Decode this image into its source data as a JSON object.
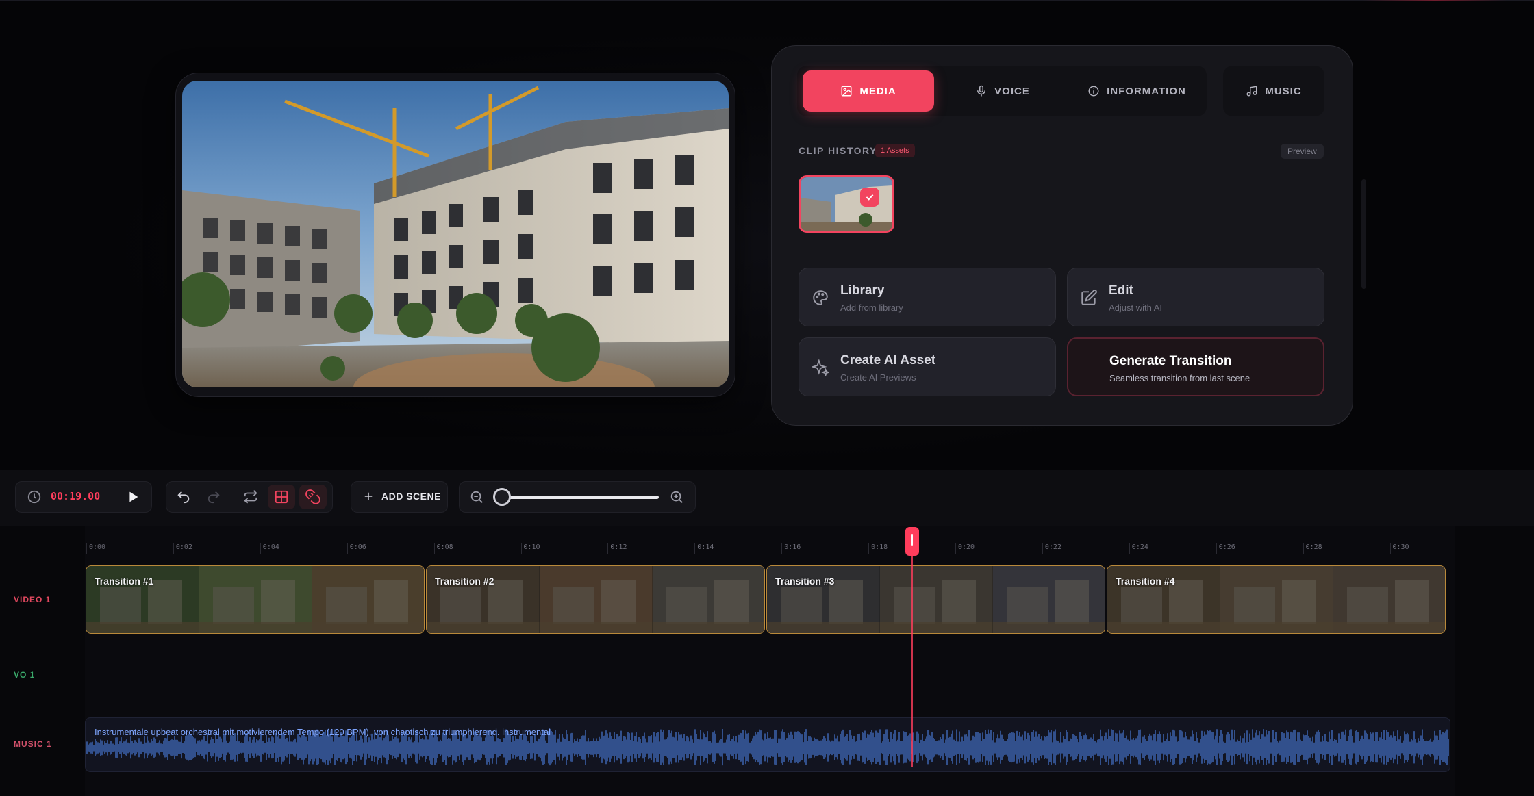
{
  "colors": {
    "accent": "#f2445f",
    "background": "#050507",
    "panel": "#16161b",
    "clip_border": "#b9893a",
    "video_label": "#e0485f",
    "vo_label": "#3aa86a",
    "music_label": "#d0506a",
    "music_wave": "#3b5fa8"
  },
  "tabs": [
    {
      "label": "MEDIA",
      "icon": "image-icon",
      "active": true
    },
    {
      "label": "VOICE",
      "icon": "microphone-icon",
      "active": false
    },
    {
      "label": "INFORMATION",
      "icon": "info-icon",
      "active": false
    },
    {
      "label": "MUSIC",
      "icon": "music-note-icon",
      "active": false
    }
  ],
  "clip_history": {
    "label": "CLIP HISTORY",
    "badge": "1 Assets",
    "preview_label": "Preview"
  },
  "actions": [
    {
      "title": "Library",
      "subtitle": "Add from library",
      "icon": "palette-icon"
    },
    {
      "title": "Edit",
      "subtitle": "Adjust with AI",
      "icon": "edit-icon"
    },
    {
      "title": "Create AI Asset",
      "subtitle": "Create AI Previews",
      "icon": "sparkles-icon"
    },
    {
      "title": "Generate Transition",
      "subtitle": "Seamless transition from last scene",
      "icon": ""
    }
  ],
  "toolbar": {
    "timecode": "00:19.00",
    "add_scene_label": "ADD SCENE",
    "zoom_level": 0.0
  },
  "ruler": {
    "ticks": [
      "0:00",
      "0:02",
      "0:04",
      "0:06",
      "0:08",
      "0:10",
      "0:12",
      "0:14",
      "0:16",
      "0:18",
      "0:20",
      "0:22",
      "0:24",
      "0:26",
      "0:28",
      "0:30"
    ]
  },
  "tracks": {
    "video_label": "VIDEO 1",
    "vo_label": "VO 1",
    "music_label": "MUSIC 1"
  },
  "clips": [
    {
      "label": "Transition #1"
    },
    {
      "label": "Transition #2"
    },
    {
      "label": "Transition #3"
    },
    {
      "label": "Transition #4"
    }
  ],
  "music": {
    "text": "Instrumentale upbeat orchestral mit motivierendem Tempo (120 BPM), von chaotisch zu triumphierend. instrumental"
  },
  "playhead_time": "0:19"
}
